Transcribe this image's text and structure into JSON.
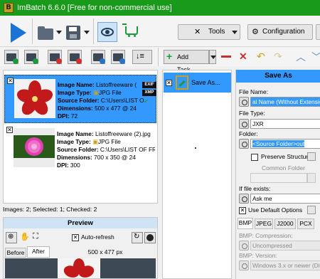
{
  "window": {
    "title": "ImBatch 6.6.0 [Free for non-commercial use]",
    "app_icon": "B"
  },
  "toolbar": {
    "tools_label": "Tools",
    "configuration_label": "Configuration",
    "more_label": "❓"
  },
  "toolbar2": {
    "add_task_label": "Add Task..."
  },
  "images": [
    {
      "checked": true,
      "selected": true,
      "name_label": "Image Name:",
      "name": "Listoffreeware (",
      "type_label": "Image Type:",
      "type": "JPG File",
      "folder_label": "Source Folder:",
      "folder": "C:\\Users\\LIST O",
      "dim_label": "Dimensions:",
      "dimensions": "500 x 477 @ 24",
      "dpi_label": "DPI:",
      "dpi": "72",
      "tags": [
        "EXIF",
        "XMP"
      ]
    },
    {
      "checked": true,
      "selected": false,
      "name_label": "Image Name:",
      "name": "Listoffreeware (2).jpg",
      "type_label": "Image Type:",
      "type": "JPG File",
      "folder_label": "Source Folder:",
      "folder": "C:\\Users\\LIST OF FREI",
      "dim_label": "Dimensions:",
      "dimensions": "700 x 350 @ 24",
      "dpi_label": "DPI:",
      "dpi": "300",
      "tags": []
    }
  ],
  "status": "Images: 2; Selected: 1; Checked: 2",
  "preview": {
    "title": "Preview",
    "auto_refresh_label": "Auto-refresh",
    "before_tab": "Before",
    "after_tab": "After",
    "size": "500 x 477 px"
  },
  "tasks": [
    {
      "label": "Save As...",
      "checked": true
    }
  ],
  "save_as": {
    "title": "Save As",
    "file_name_label": "File Name:",
    "file_name_value": "al Name (Without Extensio",
    "file_type_label": "File Type:",
    "file_type_value": "JXR",
    "folder_label": "Folder:",
    "folder_value": "<Source Folder>out",
    "preserve_label": "Preserve Structure",
    "common_folder_label": "Common Folder",
    "if_exists_label": "If file exists:",
    "if_exists_value": "Ask me",
    "default_options_label": "Use Default Options",
    "format_tabs": [
      "BMP",
      "JPEG",
      "J2000",
      "PCX"
    ],
    "compression_label": "BMP: Compression:",
    "compression_value": "Uncompressed",
    "version_label": "BMP: Version:",
    "version_value": "Windows 3.x or newer (Di"
  }
}
